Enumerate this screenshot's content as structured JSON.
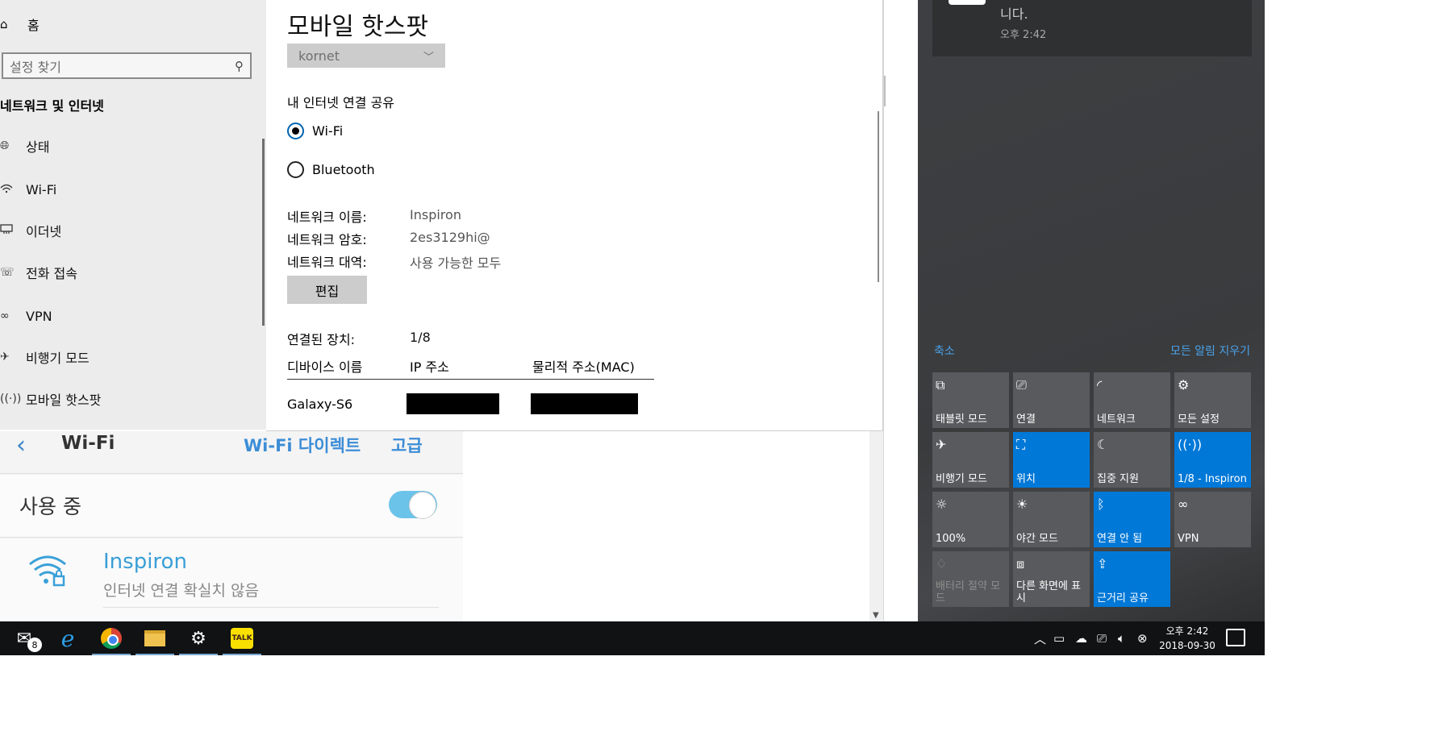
{
  "settings": {
    "sidebar": {
      "home_label": "홈",
      "search_placeholder": "설정 찾기",
      "category": "네트워크 및 인터넷",
      "items": [
        {
          "label": "상태",
          "icon": "globe-icon"
        },
        {
          "label": "Wi-Fi",
          "icon": "wifi-icon"
        },
        {
          "label": "이더넷",
          "icon": "ethernet-icon"
        },
        {
          "label": "전화 접속",
          "icon": "dialup-icon"
        },
        {
          "label": "VPN",
          "icon": "vpn-icon"
        },
        {
          "label": "비행기 모드",
          "icon": "airplane-icon"
        },
        {
          "label": "모바일 핫스팟",
          "icon": "hotspot-icon"
        }
      ]
    },
    "main": {
      "title": "모바일 핫스팟",
      "share_from_value": "kornet",
      "share_over_label": "내 인터넷 연결 공유",
      "radio_wifi": "Wi-Fi",
      "radio_bluetooth": "Bluetooth",
      "selected_radio": "Wi-Fi",
      "network_name_label": "네트워크 이름:",
      "network_name_value": "Inspiron",
      "network_password_label": "네트워크 암호:",
      "network_password_value": "2es3129hi@",
      "network_band_label": "네트워크 대역:",
      "network_band_value": "사용 가능한 모두",
      "edit_button": "편집",
      "connected_label": "연결된 장치:",
      "connected_value": "1/8",
      "table_headers": [
        "디바이스 이름",
        "IP 주소",
        "물리적 주소(MAC)"
      ],
      "devices": [
        {
          "name": "Galaxy-S6",
          "ip": "",
          "mac": ""
        }
      ]
    }
  },
  "phone": {
    "title": "Wi-Fi",
    "direct_link": "Wi-Fi 다이렉트",
    "advanced_link": "고급",
    "toggle_label": "사용 중",
    "toggle_on": true,
    "network_name": "Inspiron",
    "network_status": "인터넷 연결 확실치 않음"
  },
  "action_center": {
    "notification": {
      "body": "니다.",
      "time": "오후 2:42"
    },
    "collapse_link": "축소",
    "clear_all_link": "모든 알림 지우기",
    "tiles": [
      {
        "label": "태블릿 모드",
        "icon": "tablet-mode-icon",
        "state": "off"
      },
      {
        "label": "연결",
        "icon": "connect-icon",
        "state": "off"
      },
      {
        "label": "네트워크",
        "icon": "network-icon",
        "state": "off"
      },
      {
        "label": "모든 설정",
        "icon": "gear-icon",
        "state": "off"
      },
      {
        "label": "비행기 모드",
        "icon": "airplane-icon",
        "state": "off"
      },
      {
        "label": "위치",
        "icon": "location-icon",
        "state": "on"
      },
      {
        "label": "집중 지원",
        "icon": "moon-icon",
        "state": "off"
      },
      {
        "label": "1/8 - Inspiron",
        "icon": "hotspot-icon",
        "state": "on"
      },
      {
        "label": "100%",
        "icon": "brightness-icon",
        "state": "off"
      },
      {
        "label": "야간 모드",
        "icon": "night-light-icon",
        "state": "off"
      },
      {
        "label": "연결 안 됨",
        "icon": "bluetooth-icon",
        "state": "on"
      },
      {
        "label": "VPN",
        "icon": "vpn-icon",
        "state": "off"
      },
      {
        "label": "배터리 절약 모드",
        "icon": "battery-saver-icon",
        "state": "disabled"
      },
      {
        "label": "다른 화면에 표시",
        "icon": "project-icon",
        "state": "off"
      },
      {
        "label": "근거리 공유",
        "icon": "nearby-share-icon",
        "state": "on"
      }
    ]
  },
  "taskbar": {
    "mail_badge": "8",
    "talk_label": "TALK",
    "time": "오후 2:42",
    "date": "2018-09-30"
  },
  "colors": {
    "accent": "#0078d7",
    "tile_off": "#585a5d",
    "link": "#4aa3ea",
    "phone_accent": "#3a9fd6"
  }
}
